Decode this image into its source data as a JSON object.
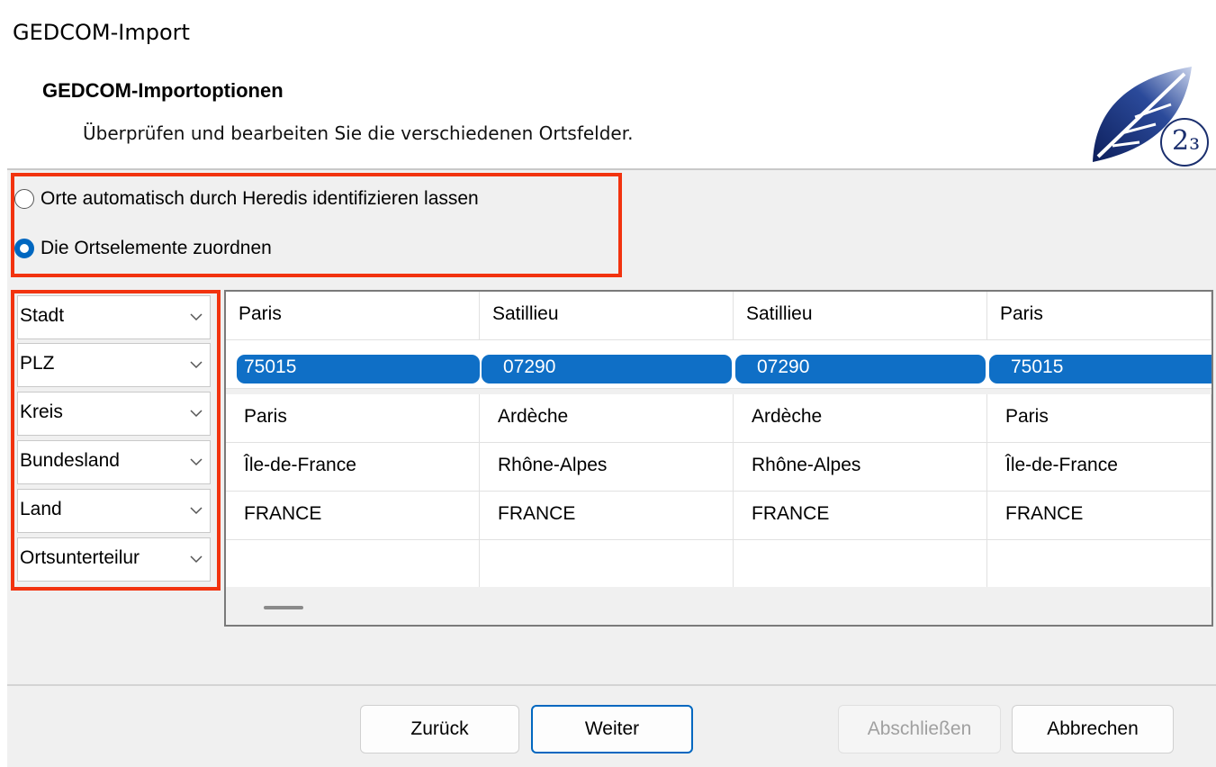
{
  "window": {
    "title": "GEDCOM-Import"
  },
  "header": {
    "title": "GEDCOM-Importoptionen",
    "subtitle": "Überprüfen und bearbeiten Sie die verschiedenen Ortsfelder.",
    "logo_text": "2₃"
  },
  "options": {
    "auto_identify": {
      "label": "Orte automatisch durch Heredis identifizieren lassen",
      "selected": false
    },
    "assign_elements": {
      "label": "Die Ortselemente zuordnen",
      "selected": true
    }
  },
  "field_mappings": [
    {
      "label": "Stadt"
    },
    {
      "label": "PLZ"
    },
    {
      "label": "Kreis"
    },
    {
      "label": "Bundesland"
    },
    {
      "label": "Land"
    },
    {
      "label": "Ortsunterteilur"
    }
  ],
  "grid": {
    "rows": [
      [
        "Paris",
        "Satillieu",
        "Satillieu",
        "Paris"
      ],
      [
        "75015",
        "07290",
        "07290",
        "75015"
      ],
      [
        "Paris",
        "Ardèche",
        "Ardèche",
        "Paris"
      ],
      [
        "Île-de-France",
        "Rhône-Alpes",
        "Rhône-Alpes",
        "Île-de-France"
      ],
      [
        "FRANCE",
        "FRANCE",
        "FRANCE",
        "FRANCE"
      ],
      [
        "",
        "",
        "",
        ""
      ]
    ],
    "selected_row": 1
  },
  "buttons": {
    "back": "Zurück",
    "next": "Weiter",
    "finish": "Abschließen",
    "cancel": "Abbrechen"
  },
  "colors": {
    "highlight": "#f2330f",
    "selection": "#0f6fc6",
    "accent": "#0067c0"
  }
}
